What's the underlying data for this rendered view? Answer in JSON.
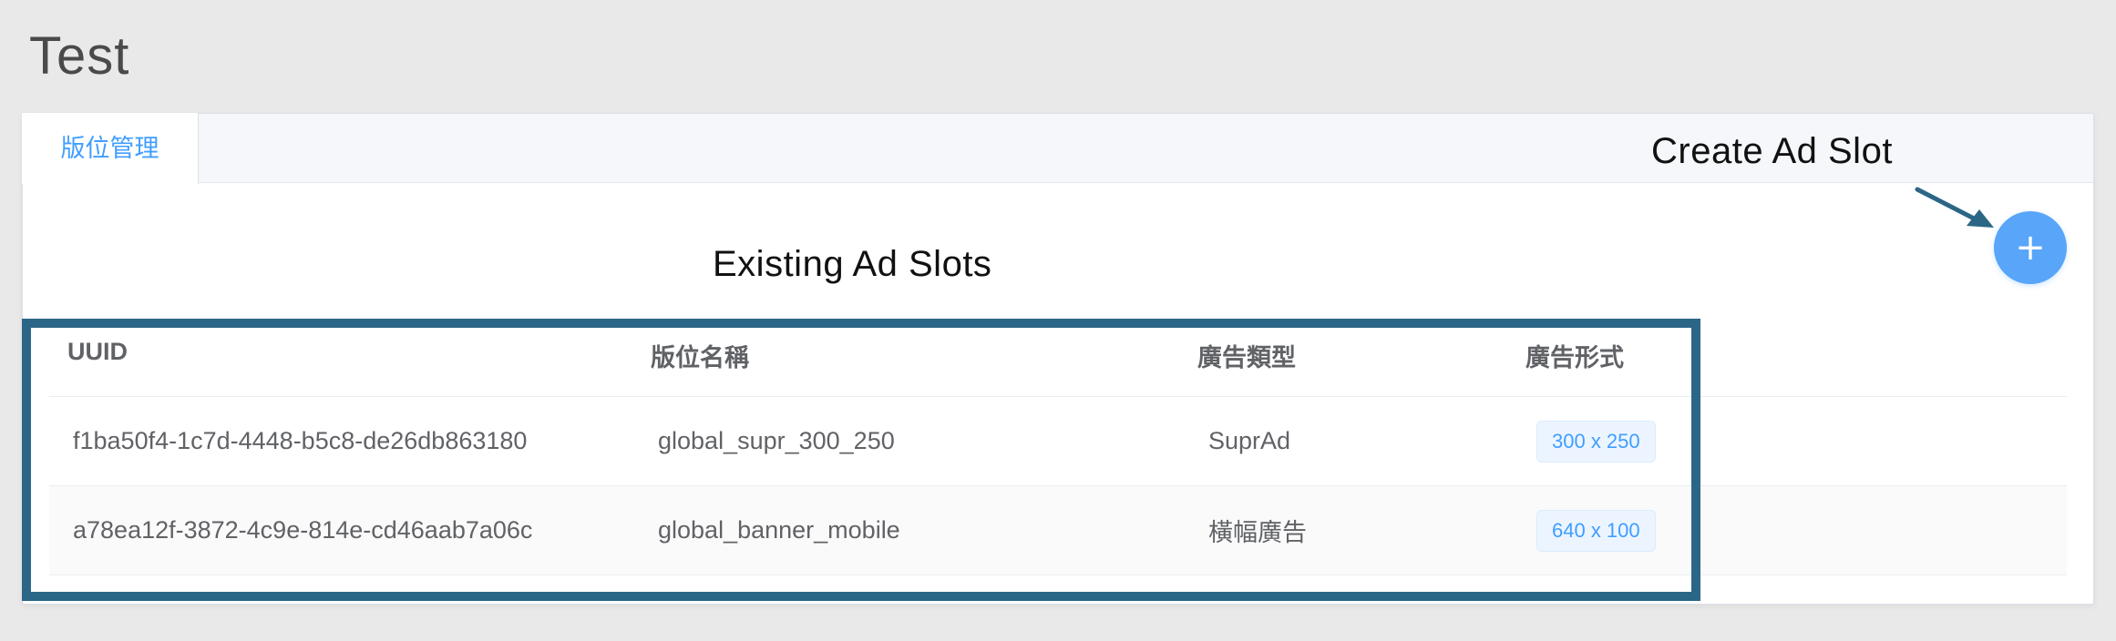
{
  "page": {
    "title": "Test"
  },
  "tabs": [
    {
      "label": "版位管理",
      "active": true
    }
  ],
  "annotations": {
    "create_label": "Create Ad Slot",
    "existing_label": "Existing Ad Slots",
    "highlight_color": "#2b6686"
  },
  "add_button": {
    "icon": "+",
    "icon_name": "plus-icon",
    "color": "#58a5f9"
  },
  "table": {
    "columns": [
      "UUID",
      "版位名稱",
      "廣告類型",
      "廣告形式"
    ],
    "rows": [
      {
        "uuid": "f1ba50f4-1c7d-4448-b5c8-de26db863180",
        "name": "global_supr_300_250",
        "type": "SuprAd",
        "format": "300 x 250"
      },
      {
        "uuid": "a78ea12f-3872-4c9e-814e-cd46aab7a06c",
        "name": "global_banner_mobile",
        "type": "橫幅廣告",
        "format": "640 x 100"
      }
    ]
  },
  "colors": {
    "accent": "#409eff",
    "background": "#e9e9e9"
  }
}
